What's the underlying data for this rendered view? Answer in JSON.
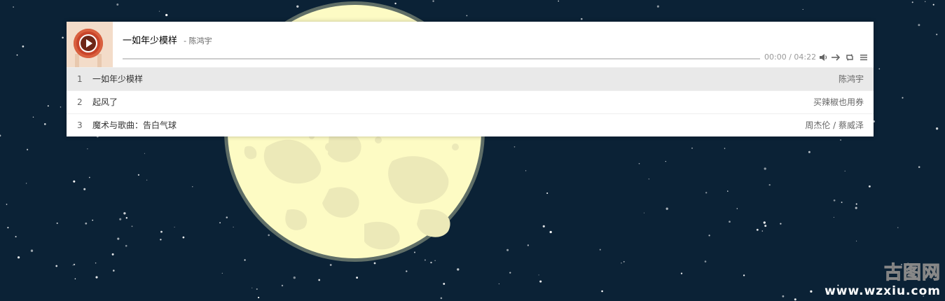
{
  "player": {
    "title": "一如年少模样",
    "author": "- 陈鸿宇",
    "time": "00:00 / 04:22",
    "progress": 0.0,
    "controls": [
      "volume-icon",
      "order-icon",
      "loop-icon",
      "menu-icon"
    ]
  },
  "playlist": [
    {
      "index": "1",
      "name": "一如年少模样",
      "artist": "陈鸿宇",
      "active": true
    },
    {
      "index": "2",
      "name": "起风了",
      "artist": "买辣椒也用券",
      "active": false
    },
    {
      "index": "3",
      "name": "魔术与歌曲：告白气球",
      "artist": "周杰伦 / 蔡威泽",
      "active": false
    }
  ],
  "watermark": {
    "logo": "古图网",
    "url": "www.wzxiu.com"
  },
  "colors": {
    "sky": "#0b2236",
    "moon": "#fdfbc4",
    "moon_spots": "#ece9b8",
    "active_row": "#e9e9e9"
  }
}
